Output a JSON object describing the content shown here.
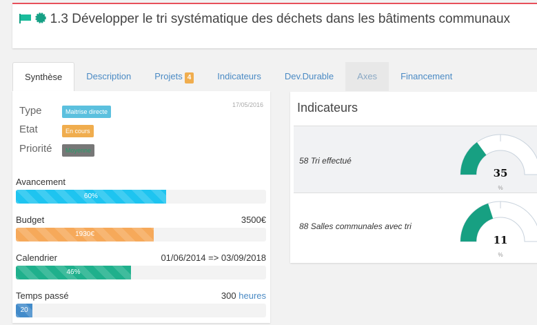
{
  "header": {
    "title": "1.3 Développer le tri systématique des déchets dans les bâtiments communaux",
    "icons": [
      "flag-icon",
      "certificate-icon"
    ],
    "accent": "#16a085"
  },
  "tabs": [
    {
      "label": "Synthèse"
    },
    {
      "label": "Description"
    },
    {
      "label": "Projets",
      "badge": "4"
    },
    {
      "label": "Indicateurs"
    },
    {
      "label": "Dev.Durable"
    },
    {
      "label": "Axes"
    },
    {
      "label": "Financement"
    }
  ],
  "synthese": {
    "date": "17/05/2016",
    "type": {
      "label": "Type",
      "value": "Maitrise directe",
      "color": "#5bc0de"
    },
    "etat": {
      "label": "Etat",
      "value": "En cours",
      "color": "#f0ad4e"
    },
    "priorite": {
      "label": "Priorité",
      "value": "Moyenne",
      "color": "#777777"
    },
    "progress": [
      {
        "label": "Avancement",
        "right": "",
        "bar_text": "60%",
        "fraction": 0.6,
        "color": "#1ec4f0"
      },
      {
        "label": "Budget",
        "right": "3500€",
        "bar_text": "1930€",
        "fraction": 0.551,
        "color": "#f6a95a"
      },
      {
        "label": "Calendrier",
        "right": "01/06/2014 => 03/09/2018",
        "bar_text": "46%",
        "fraction": 0.46,
        "color": "#1fb08c"
      },
      {
        "label": "Temps passé",
        "right": "300",
        "right_unit": "heures",
        "bar_text": "20",
        "fraction": 0.067,
        "color": "#428bca"
      }
    ]
  },
  "indicateurs": {
    "title": "Indicateurs",
    "items": [
      {
        "id": "58",
        "name": "Tri effectué",
        "value": "35",
        "unit": "%",
        "gauge_fill": 0.3
      },
      {
        "id": "88",
        "name": "Salles communales avec tri",
        "value": "11",
        "unit": "%",
        "gauge_fill": 0.4
      }
    ]
  }
}
